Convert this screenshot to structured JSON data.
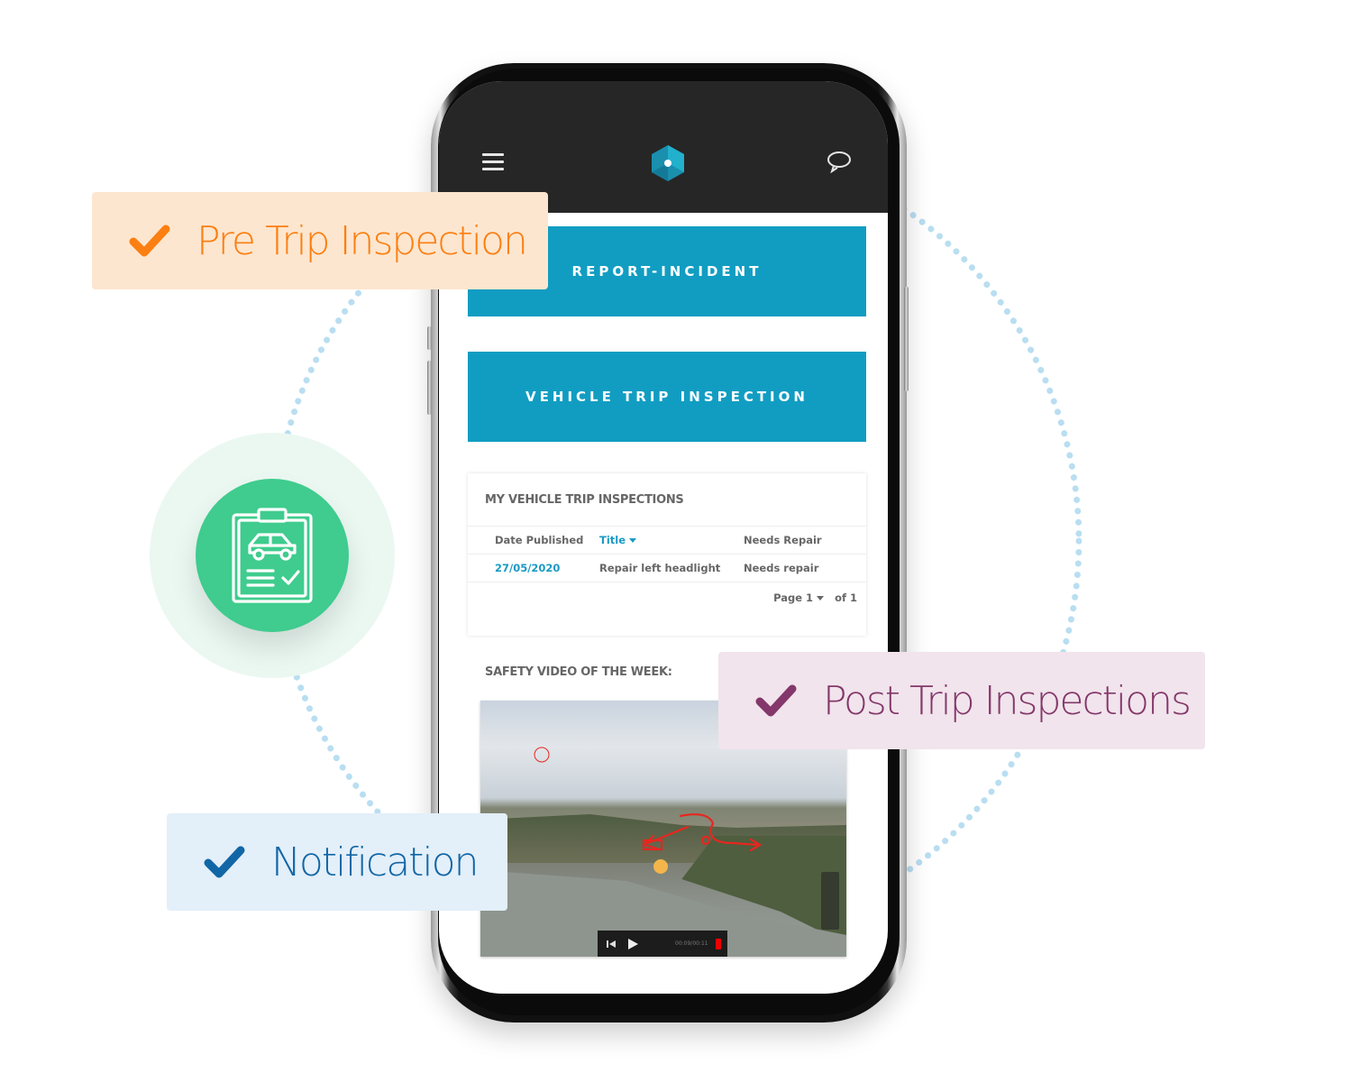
{
  "colors": {
    "accent_teal": "#119dc2",
    "topbar_bg": "#262626",
    "badge_green": "#3fcc8e",
    "orbit_dots": "#b9def1",
    "pre_trip_text": "#fb7f12",
    "pre_trip_bg": "#fde6cf",
    "post_trip_text": "#84376a",
    "post_trip_bg": "#f1e4ec",
    "notification_text": "#1166a6",
    "notification_bg": "#e3eff9"
  },
  "callouts": {
    "pre_trip": {
      "label": "Pre Trip Inspection",
      "icon": "checkmark-icon"
    },
    "post_trip": {
      "label": "Post Trip Inspections",
      "icon": "checkmark-icon"
    },
    "notification": {
      "label": "Notification",
      "icon": "checkmark-icon"
    }
  },
  "badge": {
    "icon": "clipboard-car-checklist-icon"
  },
  "app": {
    "header": {
      "menu_icon": "hamburger-menu-icon",
      "logo_icon": "hexagon-logo-icon",
      "chat_icon": "chat-bubble-icon"
    },
    "buttons": {
      "report_incident": "REPORT-INCIDENT",
      "vehicle_trip_inspection": "VEHICLE TRIP INSPECTION"
    },
    "inspections_card": {
      "title": "MY VEHICLE TRIP INSPECTIONS",
      "columns": [
        "Date Published",
        "Title",
        "Needs Repair"
      ],
      "rows": [
        [
          "27/05/2020",
          "Repair left headlight",
          "Needs repair"
        ]
      ],
      "pager": {
        "page_label": "Page 1",
        "of_label": "of 1"
      }
    },
    "video_section": {
      "title": "SAFETY VIDEO OF THE WEEK:",
      "player": {
        "time": "00:09/00:11"
      }
    }
  }
}
